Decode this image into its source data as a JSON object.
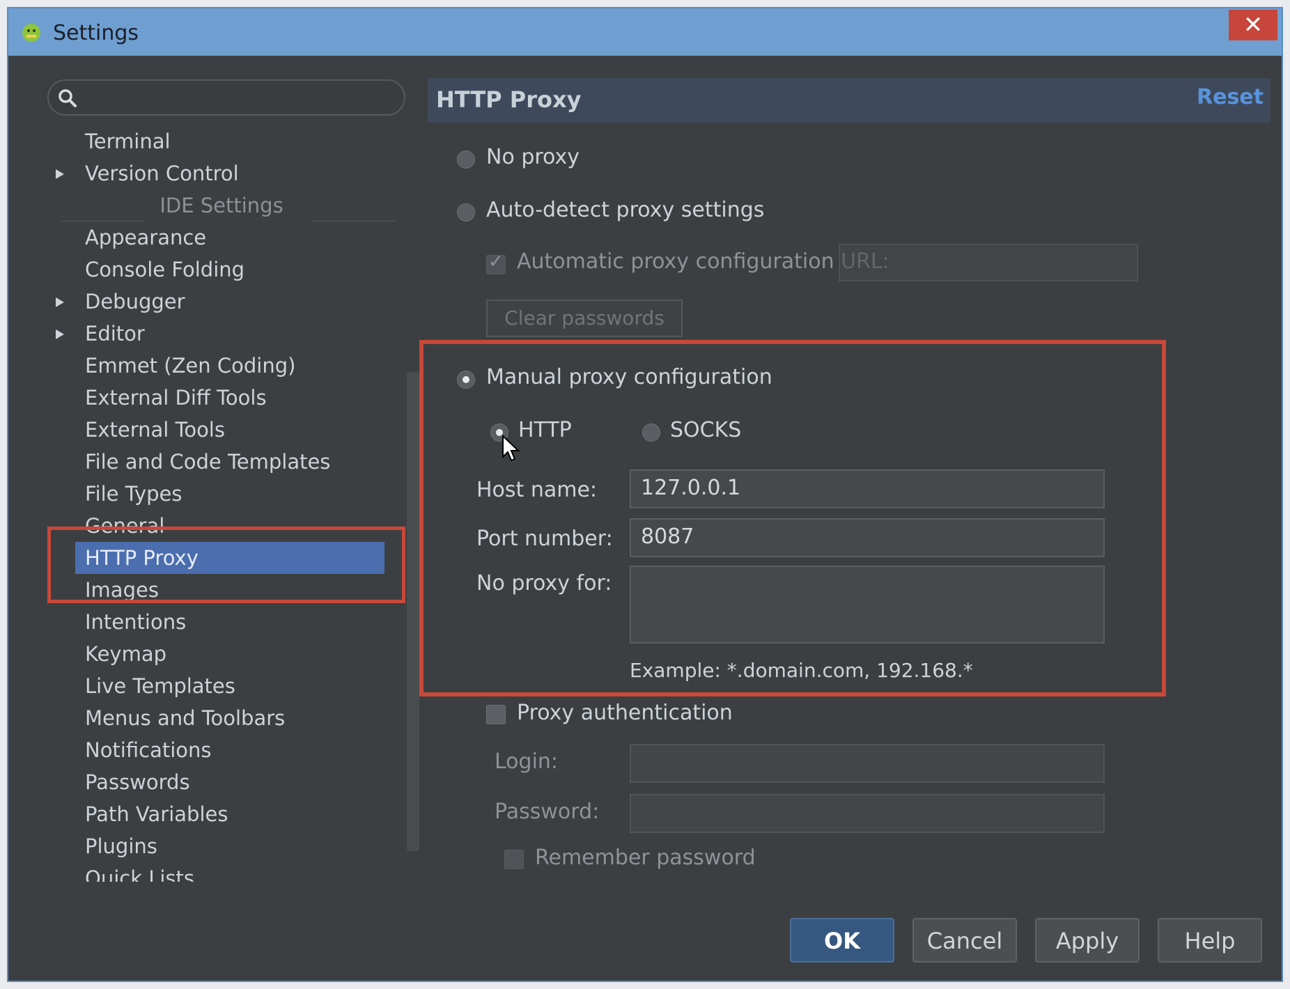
{
  "window": {
    "title": "Settings",
    "close_glyph": "✕"
  },
  "search": {
    "placeholder": ""
  },
  "tree": {
    "items": [
      {
        "label": "Terminal",
        "expandable": false
      },
      {
        "label": "Version Control",
        "expandable": true
      },
      {
        "label": "IDE Settings",
        "header": true
      },
      {
        "label": "Appearance",
        "expandable": false
      },
      {
        "label": "Console Folding",
        "expandable": false
      },
      {
        "label": "Debugger",
        "expandable": true
      },
      {
        "label": "Editor",
        "expandable": true
      },
      {
        "label": "Emmet (Zen Coding)",
        "expandable": false
      },
      {
        "label": "External Diff Tools",
        "expandable": false
      },
      {
        "label": "External Tools",
        "expandable": false
      },
      {
        "label": "File and Code Templates",
        "expandable": false
      },
      {
        "label": "File Types",
        "expandable": false
      },
      {
        "label": "General",
        "expandable": false
      },
      {
        "label": "HTTP Proxy",
        "expandable": false,
        "selected": true
      },
      {
        "label": "Images",
        "expandable": false
      },
      {
        "label": "Intentions",
        "expandable": false
      },
      {
        "label": "Keymap",
        "expandable": false
      },
      {
        "label": "Live Templates",
        "expandable": false
      },
      {
        "label": "Menus and Toolbars",
        "expandable": false
      },
      {
        "label": "Notifications",
        "expandable": false
      },
      {
        "label": "Passwords",
        "expandable": false
      },
      {
        "label": "Path Variables",
        "expandable": false
      },
      {
        "label": "Plugins",
        "expandable": false
      },
      {
        "label": "Quick Lists",
        "expandable": false
      }
    ]
  },
  "panel": {
    "title": "HTTP Proxy",
    "reset_label": "Reset",
    "no_proxy_label": "No proxy",
    "auto_detect_label": "Auto-detect proxy settings",
    "auto_config_url_label": "Automatic proxy configuration URL:",
    "auto_config_url_value": "",
    "clear_passwords_label": "Clear passwords",
    "manual_label": "Manual proxy configuration",
    "http_label": "HTTP",
    "socks_label": "SOCKS",
    "host_label": "Host name:",
    "host_value": "127.0.0.1",
    "port_label": "Port number:",
    "port_value": "8087",
    "no_proxy_for_label": "No proxy for:",
    "no_proxy_for_value": "",
    "example_text": "Example: *.domain.com, 192.168.*",
    "proxy_auth_label": "Proxy authentication",
    "login_label": "Login:",
    "login_value": "",
    "password_label": "Password:",
    "password_value": "",
    "remember_password_label": "Remember password",
    "selected_proxy_mode": "manual",
    "selected_protocol": "http"
  },
  "buttons": {
    "ok": "OK",
    "cancel": "Cancel",
    "apply": "Apply",
    "help": "Help"
  },
  "colors": {
    "accent": "#4b6eaf",
    "highlight": "#c8483a",
    "titlebar": "#6f9fd1",
    "link": "#5a93dd"
  }
}
